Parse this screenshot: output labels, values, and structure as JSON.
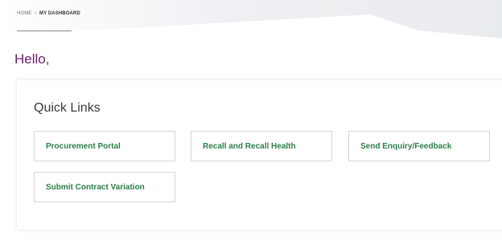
{
  "breadcrumb": {
    "home": "HOME",
    "separator": ">",
    "current": "MY DASHBOARD"
  },
  "greeting": "Hello,",
  "quick_links": {
    "title": "Quick Links",
    "links": [
      {
        "label": "Procurement Portal"
      },
      {
        "label": "Recall and Recall Health"
      },
      {
        "label": "Send Enquiry/Feedback"
      },
      {
        "label": "Submit Contract Variation"
      }
    ]
  },
  "colors": {
    "accent": "#6a1d6f",
    "link_text": "#2d7e4a",
    "header_band": "#f1eff3"
  }
}
